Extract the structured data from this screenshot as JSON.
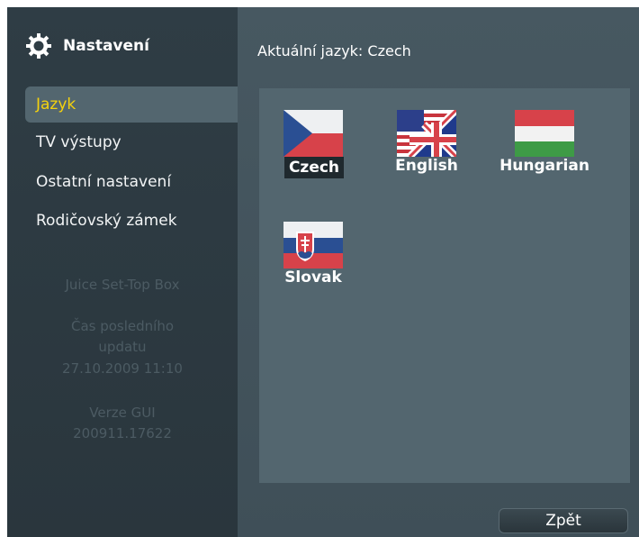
{
  "sidebar": {
    "title": "Nastavení",
    "items": [
      {
        "label": "Jazyk",
        "active": true
      },
      {
        "label": "TV výstupy",
        "active": false
      },
      {
        "label": "Ostatní nastavení",
        "active": false
      },
      {
        "label": "Rodičovský zámek",
        "active": false
      }
    ],
    "device_name": "Juice Set-Top Box",
    "last_update_label_1": "Čas posledního",
    "last_update_label_2": "updatu",
    "last_update_value": "27.10.2009 11:10",
    "gui_version_label": "Verze GUI",
    "gui_version_value": "200911.17622"
  },
  "main": {
    "current_language": "Aktuální jazyk: Czech",
    "languages": [
      {
        "label": "Czech",
        "flag": "czech-flag-icon",
        "selected": true
      },
      {
        "label": "English",
        "flag": "uk-us-flag-icon",
        "selected": false
      },
      {
        "label": "Hungarian",
        "flag": "hungary-flag-icon",
        "selected": false
      },
      {
        "label": "Slovak",
        "flag": "slovakia-flag-icon",
        "selected": false
      }
    ],
    "back_label": "Zpět"
  },
  "colors": {
    "accent": "#f5d20d",
    "sidebar_bg": "#2f3d45",
    "main_bg": "#475861",
    "panel_bg": "#53666f"
  }
}
